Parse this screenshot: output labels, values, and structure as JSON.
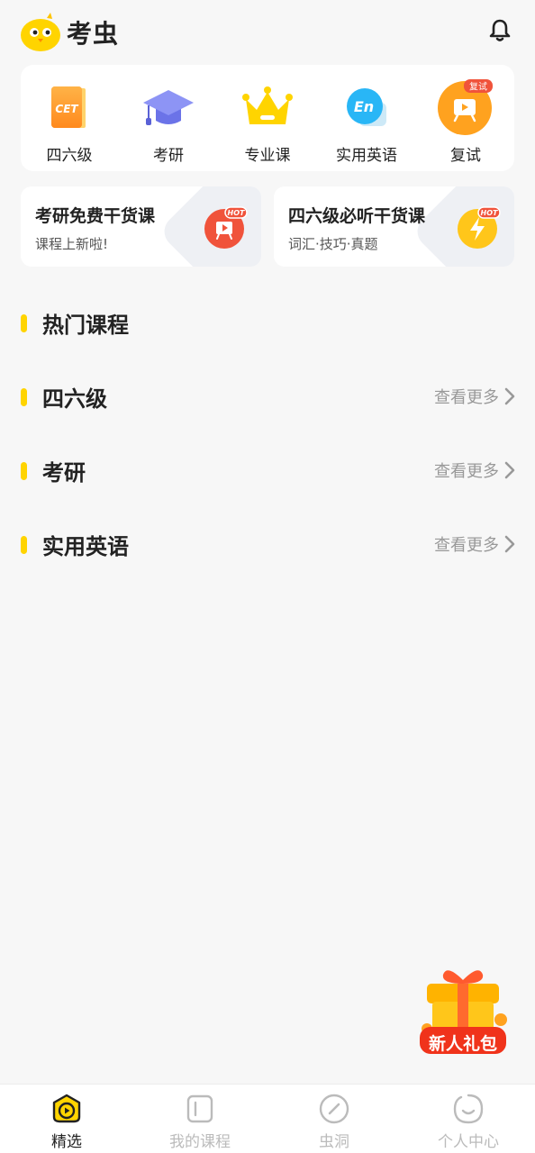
{
  "header": {
    "app_name": "考虫",
    "logo_icon": "chick-logo-icon",
    "bell_icon": "bell-icon"
  },
  "categories": [
    {
      "label": "四六级",
      "icon": "cet-book-icon"
    },
    {
      "label": "考研",
      "icon": "graduation-cap-icon"
    },
    {
      "label": "专业课",
      "icon": "crown-icon"
    },
    {
      "label": "实用英语",
      "icon": "en-bubble-icon"
    },
    {
      "label": "复试",
      "icon": "easel-icon",
      "badge": "复试"
    }
  ],
  "cet_icon_text": "CET",
  "en_icon_text": "En",
  "promos": [
    {
      "title": "考研免费干货课",
      "subtitle": "课程上新啦!",
      "badge": "HOT",
      "icon": "hot-video-icon"
    },
    {
      "title": "四六级必听干货课",
      "subtitle": "词汇·技巧·真题",
      "badge": "HOT",
      "icon": "hot-lightning-icon"
    }
  ],
  "sections": [
    {
      "title": "热门课程",
      "more": ""
    },
    {
      "title": "四六级",
      "more": "查看更多"
    },
    {
      "title": "考研",
      "more": "查看更多"
    },
    {
      "title": "实用英语",
      "more": "查看更多"
    }
  ],
  "gift": {
    "label": "新人礼包",
    "icon": "gift-box-icon"
  },
  "bottom_nav": [
    {
      "label": "精选",
      "icon": "play-badge-icon",
      "active": true
    },
    {
      "label": "我的课程",
      "icon": "course-book-icon",
      "active": false
    },
    {
      "label": "虫洞",
      "icon": "compass-icon",
      "active": false
    },
    {
      "label": "个人中心",
      "icon": "smile-icon",
      "active": false
    }
  ],
  "colors": {
    "accent": "#ffd400",
    "background": "#f7f7f7",
    "hot": "#f0533b",
    "inactive": "#bbbbbb"
  }
}
